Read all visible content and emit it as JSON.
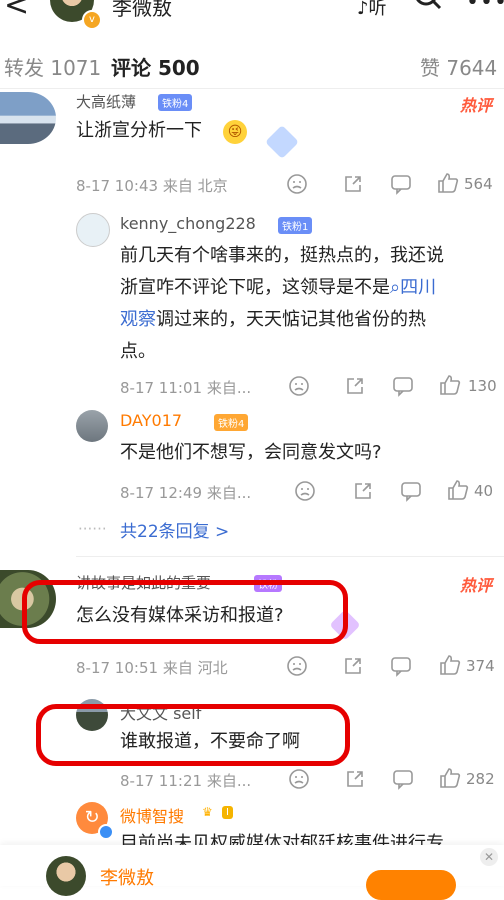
{
  "topbar": {
    "back_icon": "chevron-left-icon",
    "name": "李微敖",
    "listen_label": "听",
    "search_icon": "search-icon",
    "more_icon": "more-icon"
  },
  "tabs": [
    {
      "label": "转发 1071"
    },
    {
      "label": "评论 500"
    },
    {
      "label": "赞 7644"
    }
  ],
  "comments": [
    {
      "user": "大高纸薄",
      "badge": "铁粉4",
      "hot": "热评",
      "text": "让浙宣分析一下",
      "time": "8-17 10:43",
      "location": "来自 北京",
      "likes": "564"
    },
    {
      "user": "讲故事是如此的重要",
      "badge": "铁粉",
      "hot": "热评",
      "text": "怎么没有媒体采访和报道?",
      "time": "8-17 10:51",
      "location": "来自 河北",
      "likes": "374"
    }
  ],
  "replies": [
    {
      "user": "kenny_chong228",
      "badge": "铁粉1",
      "text_parts": [
        "前几天有个啥事来的，挺热点的，我还说",
        "浙宣咋不评论下呢，这领导是不是",
        "四川",
        "观察",
        "调过来的，天天惦记其他省份的热",
        "点。"
      ],
      "time": "8-17 11:01",
      "location": "来自...",
      "likes": "130"
    },
    {
      "user": "DAY017",
      "badge": "铁粉4",
      "text": "不是他们不想写，会同意发文吗?",
      "time": "8-17 12:49",
      "location": "来自...",
      "likes": "40"
    },
    {
      "user": "大文文 self",
      "text": "谁敢报道，不要命了啊",
      "time": "8-17 11:21",
      "location": "来自...",
      "likes": "282"
    },
    {
      "user": "微博智搜",
      "badge": "I",
      "text": "目前尚未见权威媒体对郁廷核事件进行专"
    }
  ],
  "more_replies": {
    "dots": "······",
    "label": "共22条回复 >"
  },
  "bottom": {
    "name": "李微敖"
  },
  "colors": {
    "accent": "#ff8200",
    "link": "#3b6cd1",
    "hot": "#ff5a3c",
    "annotation_red": "#e60000"
  }
}
